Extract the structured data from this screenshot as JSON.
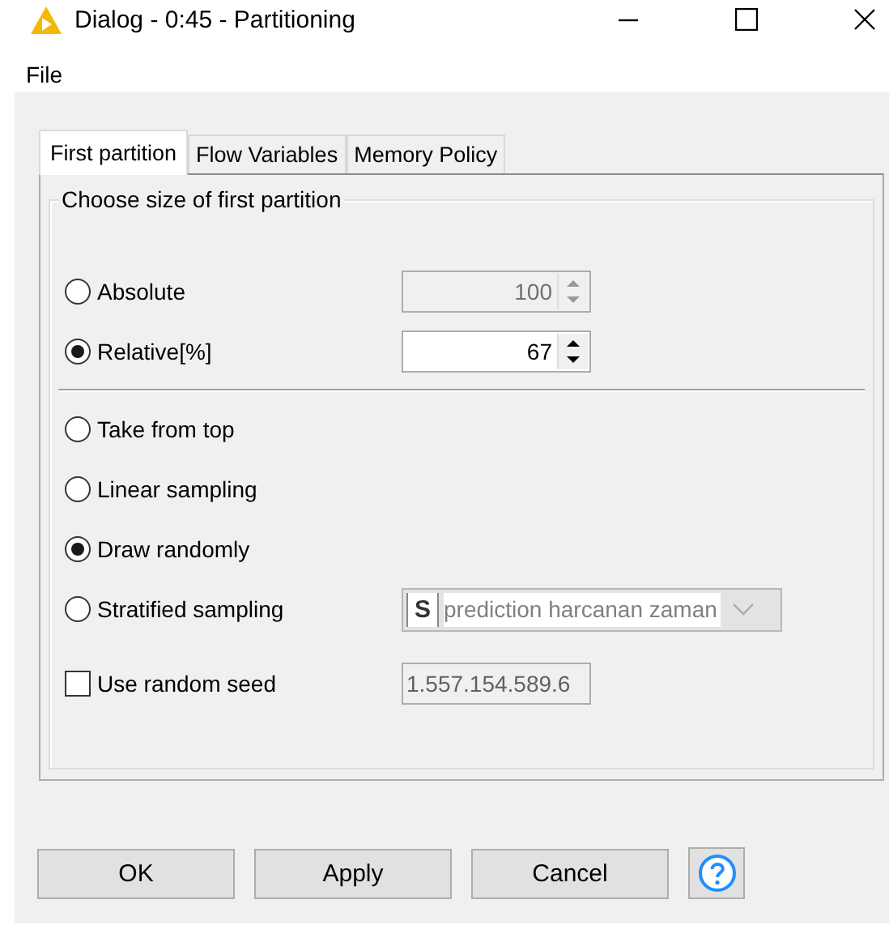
{
  "window": {
    "title": "Dialog - 0:45 - Partitioning"
  },
  "menu": [
    "File"
  ],
  "tabs": [
    {
      "label": "First partition",
      "selected": true
    },
    {
      "label": "Flow Variables",
      "selected": false
    },
    {
      "label": "Memory Policy",
      "selected": false
    }
  ],
  "group": {
    "title": "Choose size of first partition"
  },
  "size_options": [
    {
      "label": "Absolute",
      "selected": false,
      "value": "100"
    },
    {
      "label": "Relative[%]",
      "selected": true,
      "value": "67"
    }
  ],
  "method_options": [
    {
      "label": "Take from top",
      "selected": false
    },
    {
      "label": "Linear sampling",
      "selected": false
    },
    {
      "label": "Draw randomly",
      "selected": true
    },
    {
      "label": "Stratified sampling",
      "selected": false,
      "column": {
        "type_badge": "S",
        "value": "prediction harcanan zaman"
      }
    }
  ],
  "seed": {
    "label": "Use random seed",
    "checked": false,
    "value": "1.557.154.589.6"
  },
  "buttons": [
    "OK",
    "Apply",
    "Cancel"
  ]
}
